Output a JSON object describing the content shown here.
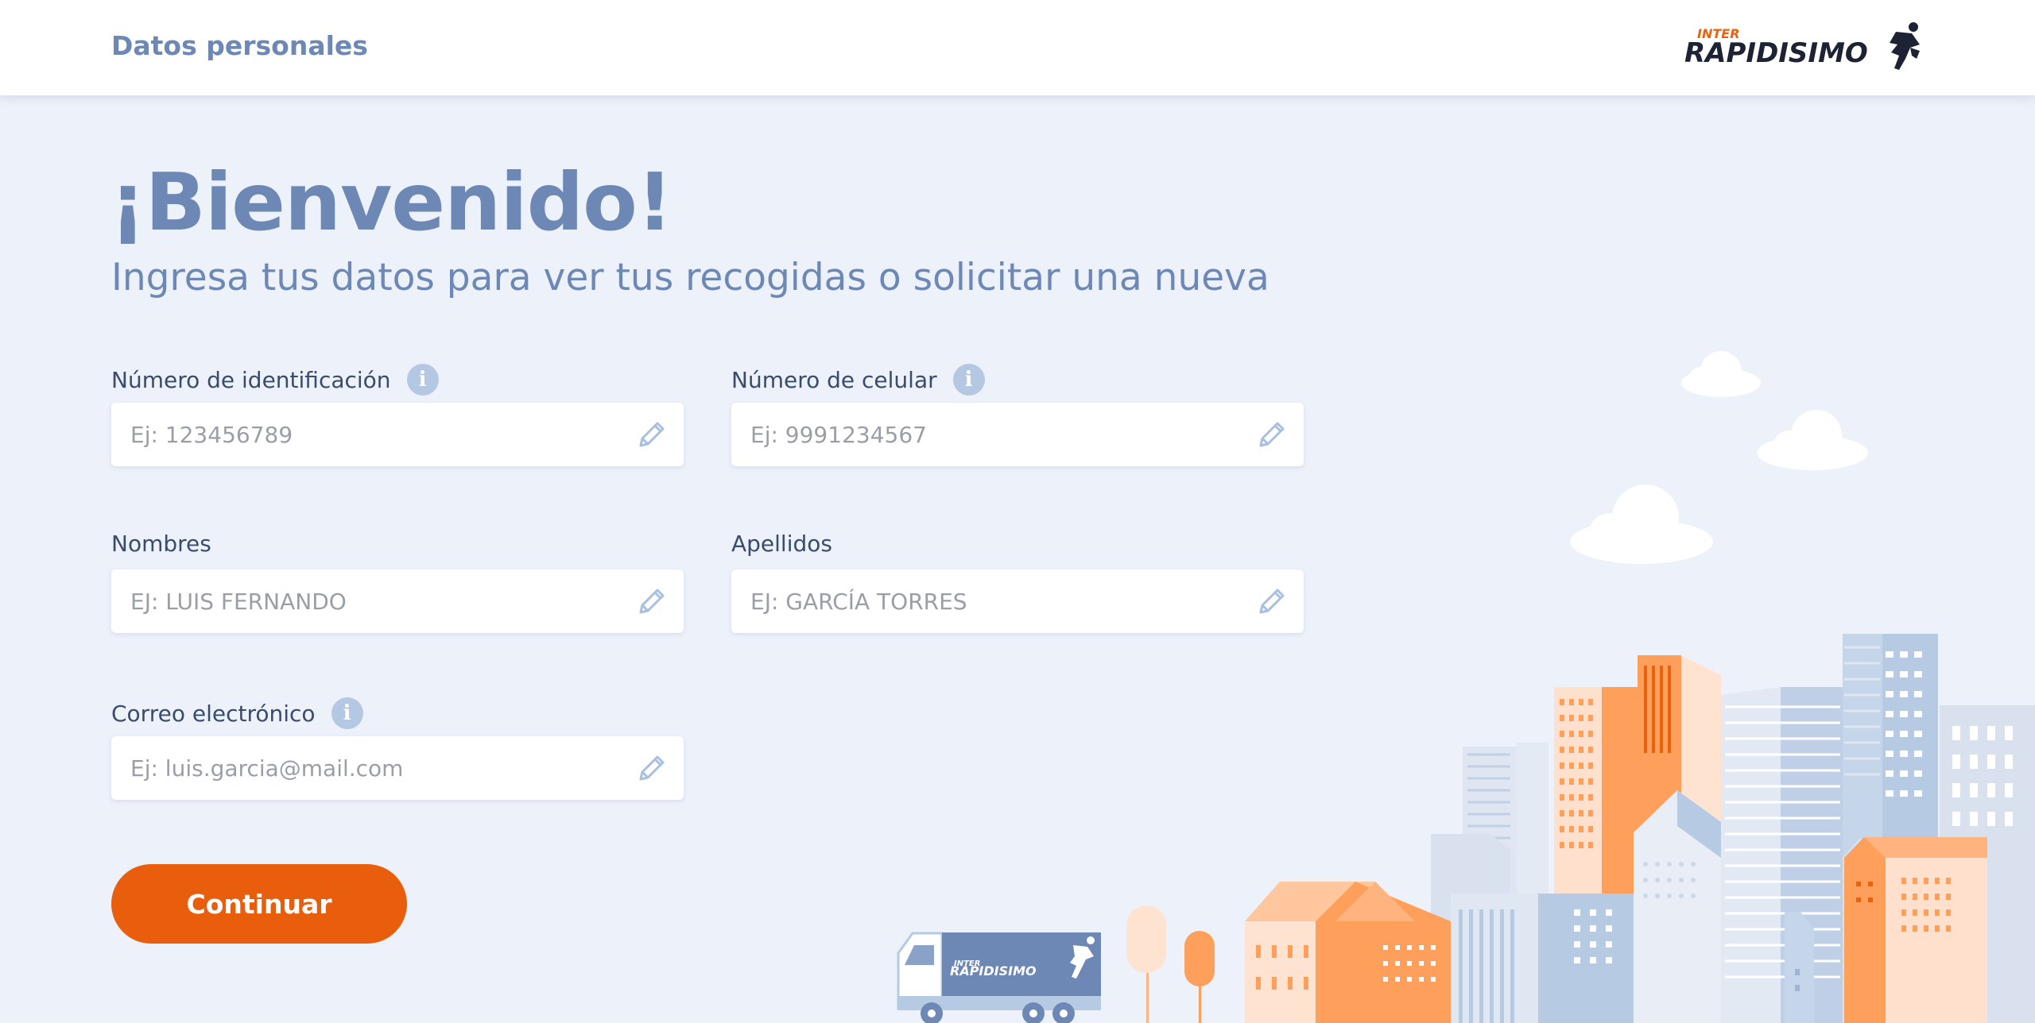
{
  "header": {
    "title": "Datos personales",
    "logo_text_top": "INTER",
    "logo_text_main": "RAPIDISIMO"
  },
  "hero": {
    "title": "¡Bienvenido!",
    "subtitle": "Ingresa tus datos para ver tus recogidas o solicitar una nueva"
  },
  "form": {
    "id_number": {
      "label": "Número de identificación",
      "placeholder": "Ej: 123456789",
      "value": ""
    },
    "phone": {
      "label": "Número de celular",
      "placeholder": "Ej: 9991234567",
      "value": ""
    },
    "first_names": {
      "label": "Nombres",
      "placeholder": "EJ: LUIS FERNANDO",
      "value": ""
    },
    "last_names": {
      "label": "Apellidos",
      "placeholder": "EJ: GARCÍA TORRES",
      "value": ""
    },
    "email": {
      "label": "Correo electrónico",
      "placeholder": "Ej: luis.garcia@mail.com",
      "value": ""
    },
    "info_icon_glyph": "i",
    "continue_label": "Continuar"
  },
  "illustration": {
    "truck_text_top": "INTER",
    "truck_text_main": "RAPIDISIMO"
  },
  "colors": {
    "accent": "#e85e0c",
    "heading": "#6d88b5",
    "background": "#ecf1fa",
    "info_icon": "#b4c7e3"
  },
  "icons": {
    "edit": "pencil-icon",
    "info": "info-icon"
  }
}
